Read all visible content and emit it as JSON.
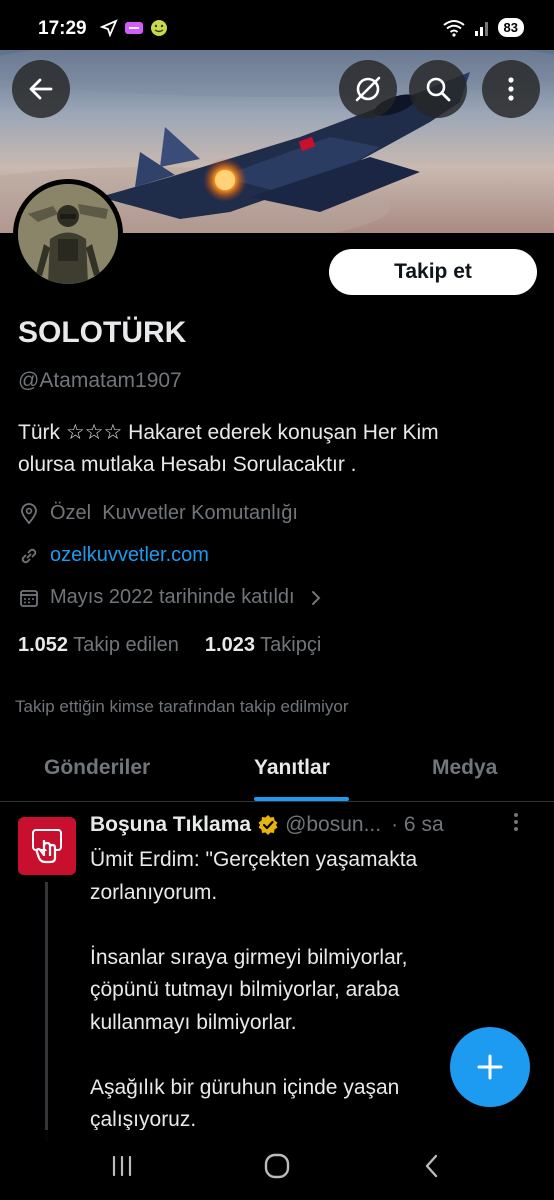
{
  "status_bar": {
    "time": "17:29",
    "battery": "83",
    "icons": [
      "location-icon",
      "app-notification-icon",
      "smiley-app-icon",
      "wifi-icon",
      "signal-icon"
    ]
  },
  "header": {
    "back_icon": "arrow-left-icon",
    "grok_icon": "grok-icon",
    "search_icon": "search-icon",
    "more_icon": "more-vertical-icon"
  },
  "profile": {
    "follow_label": "Takip et",
    "display_name": "SOLOTÜRK",
    "handle": "@Atamatam1907",
    "bio_line1": "Türk ☆☆☆ Hakaret ederek konuşan Her Kim",
    "bio_line2": "olursa mutlaka Hesabı Sorulacaktır .",
    "location": "Özel  Kuvvetler Komutanlığı",
    "website": "ozelkuvvetler.com",
    "joined": "Mayıs 2022 tarihinde katıldı",
    "following_count": "1.052",
    "following_label": "Takip edilen",
    "followers_count": "1.023",
    "followers_label": "Takipçi",
    "not_followed_note": "Takip ettiğin kimse tarafından takip edilmiyor"
  },
  "tabs": [
    {
      "label": "Gönderiler"
    },
    {
      "label": "Yanıtlar",
      "active": true
    },
    {
      "label": "Medya"
    }
  ],
  "tweet": {
    "author_name": "Boşuna Tıklama",
    "author_handle": "@bosun...",
    "time": "· 6 sa",
    "verified_color": "#e8b30a",
    "text": "Ümit Erdim: \"Gerçekten yaşamakta\nzorlanıyorum.\n\nİnsanlar sıraya girmeyi bilmiyorlar,\nçöpünü tutmayı bilmiyorlar, araba\nkullanmayı bilmiyorlar.\n\nAşağılık bir güruhun içinde yaşan\nçalışıyoruz."
  },
  "fab": {
    "icon": "plus-icon"
  },
  "colors": {
    "accent": "#1d9bf0",
    "background": "#000000",
    "muted": "#71767b"
  }
}
